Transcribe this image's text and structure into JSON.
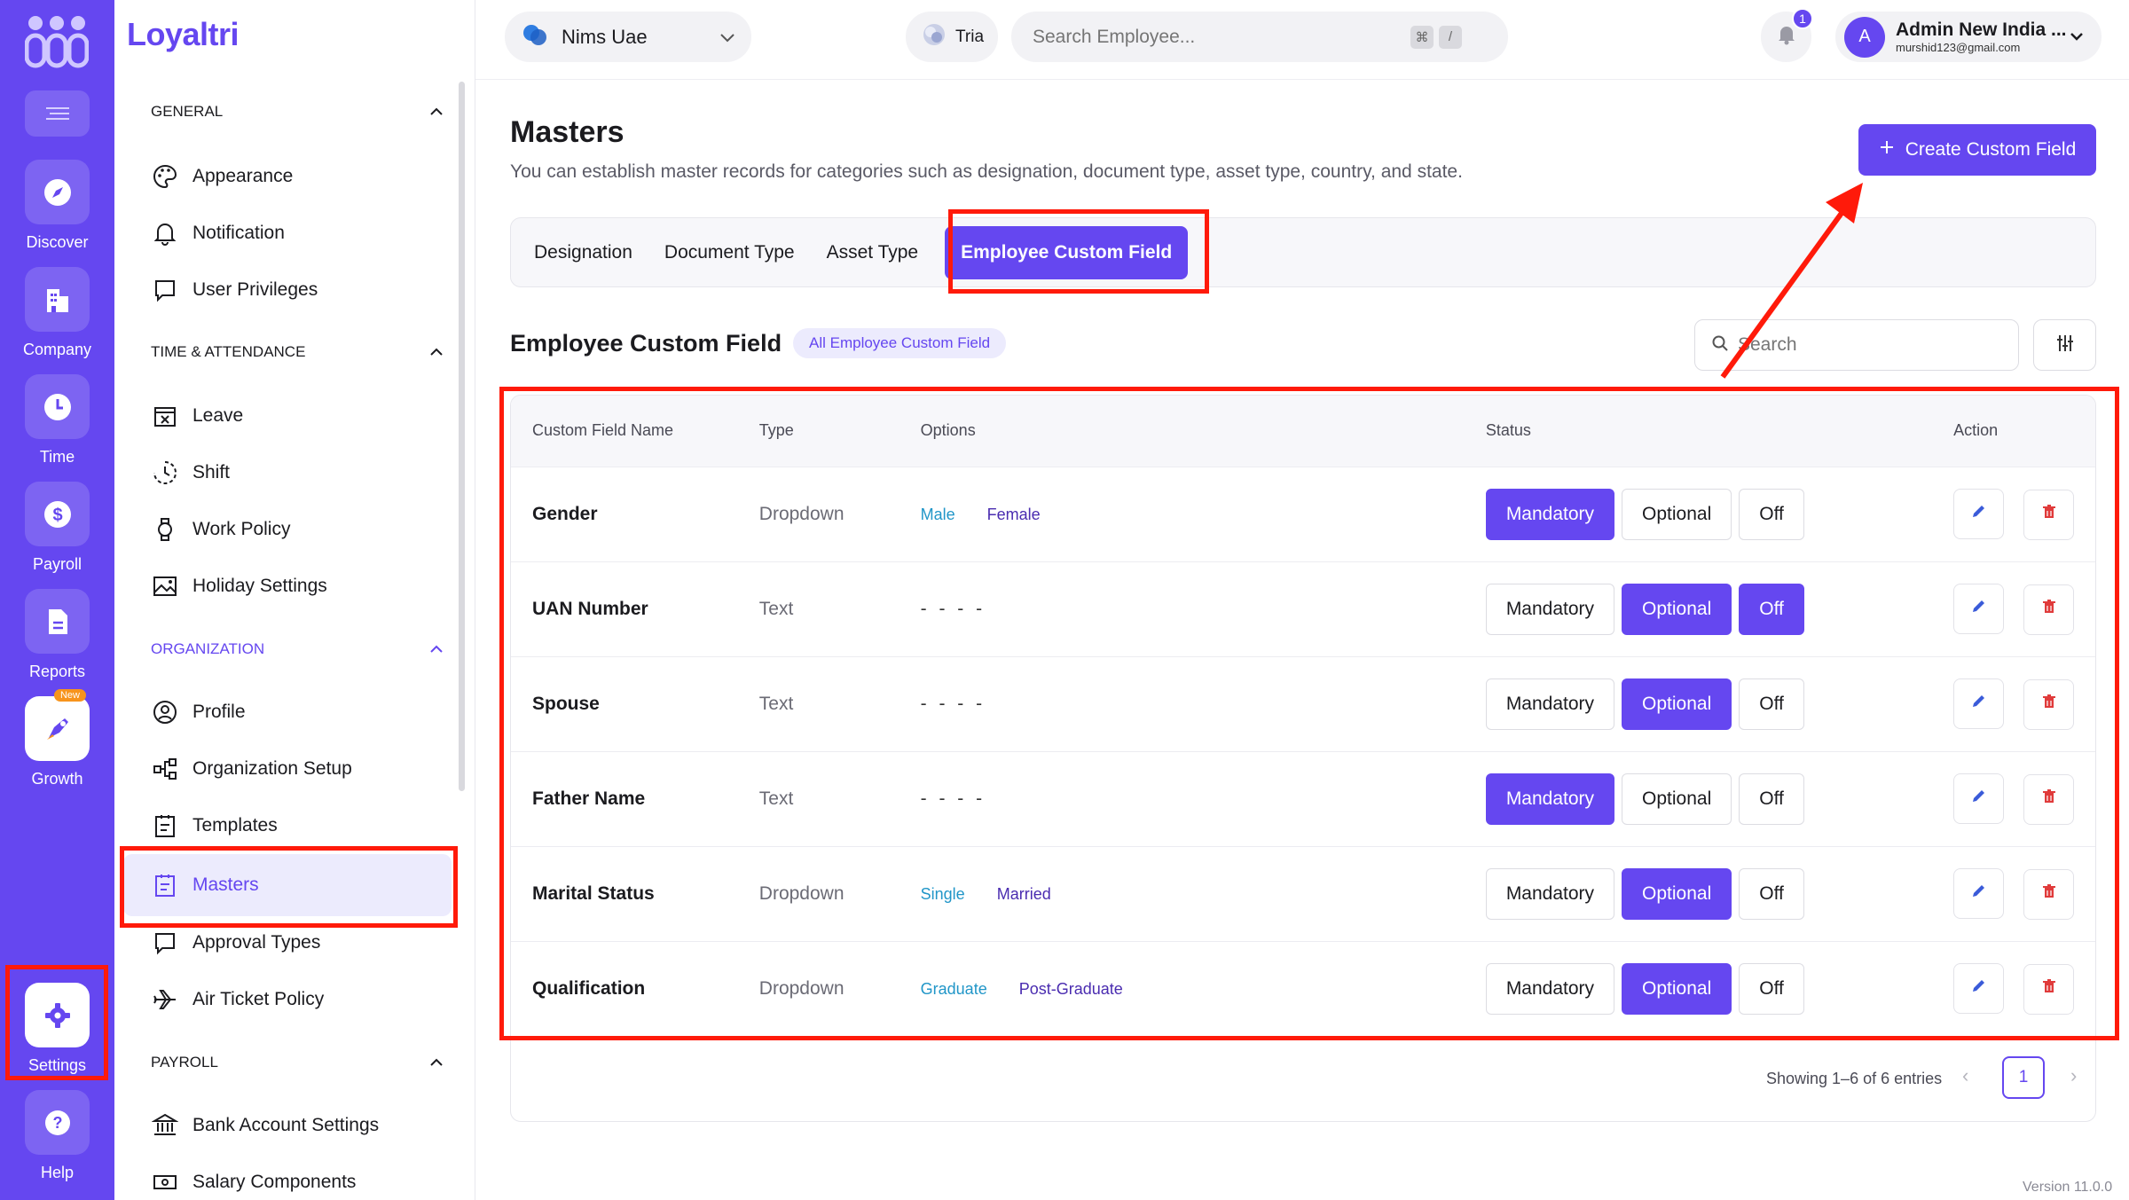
{
  "rail": {
    "collapse_icon": "menu-lines-icon",
    "items": [
      {
        "label": "Discover",
        "icon": "compass-icon"
      },
      {
        "label": "Company",
        "icon": "building-icon"
      },
      {
        "label": "Time",
        "icon": "clock-icon"
      },
      {
        "label": "Payroll",
        "icon": "dollar-icon"
      },
      {
        "label": "Reports",
        "icon": "document-icon"
      },
      {
        "label": "Growth",
        "icon": "rocket-icon",
        "badge": "New"
      },
      {
        "label": "Settings",
        "icon": "gear-icon"
      },
      {
        "label": "Help",
        "icon": "help-icon"
      }
    ]
  },
  "nav": {
    "brand": "Loyaltri",
    "sections": {
      "general": {
        "title": "GENERAL",
        "items": [
          "Appearance",
          "Notification",
          "User Privileges"
        ]
      },
      "time": {
        "title": "TIME & ATTENDANCE",
        "items": [
          "Leave",
          "Shift",
          "Work Policy",
          "Holiday Settings"
        ]
      },
      "org": {
        "title": "ORGANIZATION",
        "items": [
          "Profile",
          "Organization Setup",
          "Templates",
          "Masters",
          "Approval Types",
          "Air Ticket Policy"
        ]
      },
      "payroll": {
        "title": "PAYROLL",
        "items": [
          "Bank Account Settings",
          "Salary Components"
        ]
      }
    }
  },
  "topbar": {
    "org_name": "Nims Uae",
    "tria_label": "Tria",
    "search_placeholder": "Search Employee...",
    "shortcut_key1": "⌘",
    "shortcut_key2": "/",
    "notification_count": "1",
    "user_initial": "A",
    "user_name": "Admin New India ...",
    "user_email": "murshid123@gmail.com"
  },
  "main": {
    "title": "Masters",
    "subtitle": "You can establish master records for categories such as designation, document type, asset type, country, and state.",
    "create_button": "Create Custom Field",
    "tabs": [
      "Designation",
      "Document Type",
      "Asset Type",
      "Employee Custom Field"
    ],
    "active_tab": "Employee Custom Field",
    "section_title": "Employee Custom Field",
    "section_chip": "All Employee Custom Field",
    "search_placeholder": "Search",
    "table": {
      "columns": [
        "Custom Field Name",
        "Type",
        "Options",
        "Status",
        "Action"
      ],
      "status_labels": [
        "Mandatory",
        "Optional",
        "Off"
      ],
      "rows": [
        {
          "name": "Gender",
          "type": "Dropdown",
          "options": [
            "Male",
            "Female"
          ],
          "status": [
            "Mandatory"
          ]
        },
        {
          "name": "UAN Number",
          "type": "Text",
          "options": [],
          "status": [
            "Optional",
            "Off"
          ]
        },
        {
          "name": "Spouse",
          "type": "Text",
          "options": [],
          "status": [
            "Optional"
          ]
        },
        {
          "name": "Father Name",
          "type": "Text",
          "options": [],
          "status": [
            "Mandatory"
          ]
        },
        {
          "name": "Marital Status",
          "type": "Dropdown",
          "options": [
            "Single",
            "Married"
          ],
          "status": [
            "Optional"
          ]
        },
        {
          "name": "Qualification",
          "type": "Dropdown",
          "options": [
            "Graduate",
            "Post-Graduate"
          ],
          "status": [
            "Optional"
          ]
        }
      ],
      "empty_options": "- - - -"
    },
    "pagination": {
      "summary": "Showing 1–6 of 6 entries",
      "current_page": "1"
    },
    "version": "Version 11.0.0"
  },
  "colors": {
    "accent": "#6547f0",
    "annotation": "#ff1a0a"
  }
}
